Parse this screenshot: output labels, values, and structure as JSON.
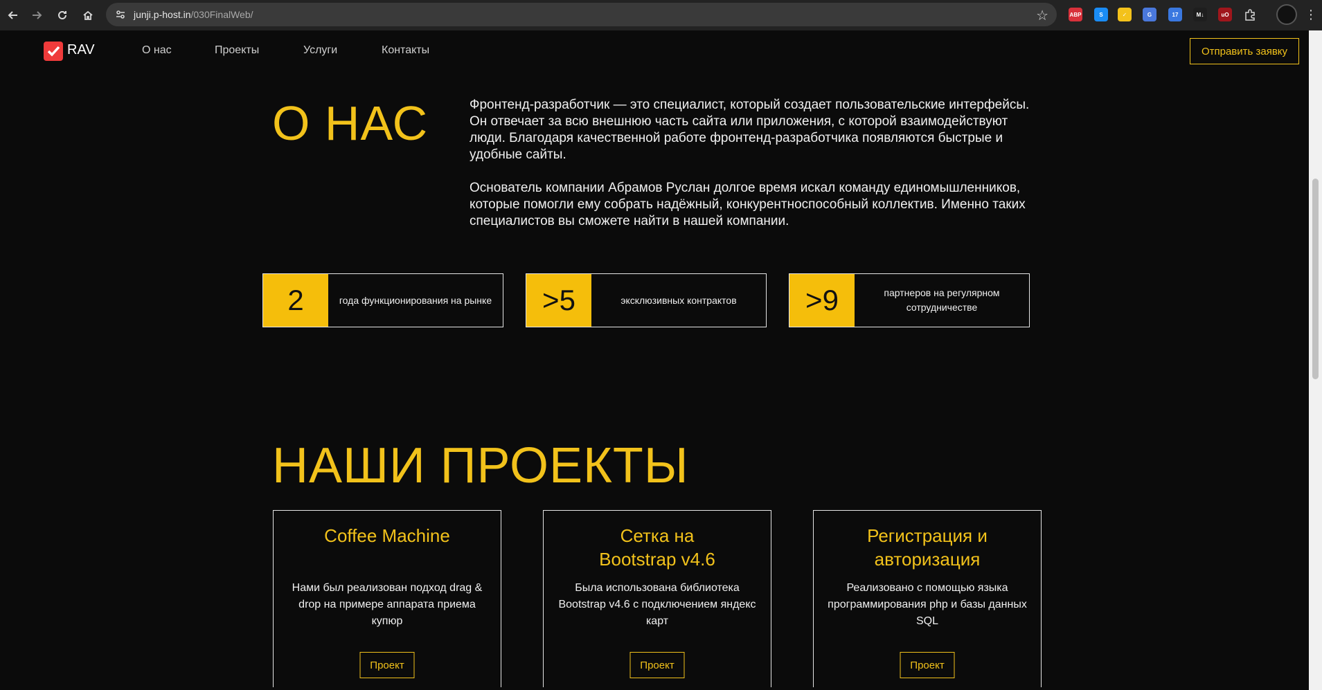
{
  "browser": {
    "url_host": "junji.p-host.in",
    "url_path": "/030FinalWeb/",
    "extensions": [
      {
        "name": "adblock-plus-icon",
        "text": "ABP",
        "color": "#d8313b"
      },
      {
        "name": "shazam-icon",
        "text": "S",
        "color": "#1a8cf5"
      },
      {
        "name": "norton-icon",
        "text": "✓",
        "color": "#f4c21b"
      },
      {
        "name": "translate-icon",
        "text": "G",
        "color": "#4a78dc"
      },
      {
        "name": "calendar-ext-icon",
        "text": "17",
        "color": "#3a78e0"
      },
      {
        "name": "markdown-icon",
        "text": "M↓",
        "color": "#1e1e1e"
      },
      {
        "name": "ublock-icon",
        "text": "uO",
        "color": "#a0161c"
      },
      {
        "name": "extensions-puzzle-icon",
        "text": "",
        "color": "#232323"
      }
    ]
  },
  "header": {
    "logo": "RAV",
    "menu": [
      "О нас",
      "Проекты",
      "Услуги",
      "Контакты"
    ],
    "cta": "Отправить заявку"
  },
  "about": {
    "title": "О НАС",
    "p1": "Фронтенд-разработчик — это специалист, который создает пользовательские интерфейсы. Он отвечает за всю внешнюю часть сайта или приложения, с которой взаимодействуют люди. Благодаря качественной работе фронтенд-разработчика появляются быстрые и удобные сайты.",
    "p2": "Основатель компании Абрамов Руслан долгое время искал команду единомышленников, которые помогли ему собрать надёжный, конкурентноспособный коллектив. Именно таких специалистов вы сможете найти в нашей компании.",
    "stats": [
      {
        "value": "2",
        "label": "года функционирования на рынке"
      },
      {
        "value": ">5",
        "label": "эксклюзивных контрактов"
      },
      {
        "value": ">9",
        "label": "партнеров на регулярном сотрудничестве"
      }
    ]
  },
  "projects": {
    "title": "НАШИ ПРОЕКТЫ",
    "items": [
      {
        "title": "Coffee Machine",
        "desc": "Нами был реализован подход drag & drop на примере аппарата приема купюр",
        "button": "Проект"
      },
      {
        "title": "Сетка на Bootstrap v4.6",
        "desc": "Была использована библиотека Bootstrap v4.6 с подключением яндекс карт",
        "button": "Проект"
      },
      {
        "title": "Регистрация и авторизация",
        "desc": "Реализовано с помощью языка программирования php и базы данных SQL",
        "button": "Проект"
      }
    ]
  },
  "colors": {
    "accent": "#f2c21b",
    "background": "#0b0b0b",
    "stat_fill": "#f5be0b",
    "logo": "#ef3b3b"
  }
}
